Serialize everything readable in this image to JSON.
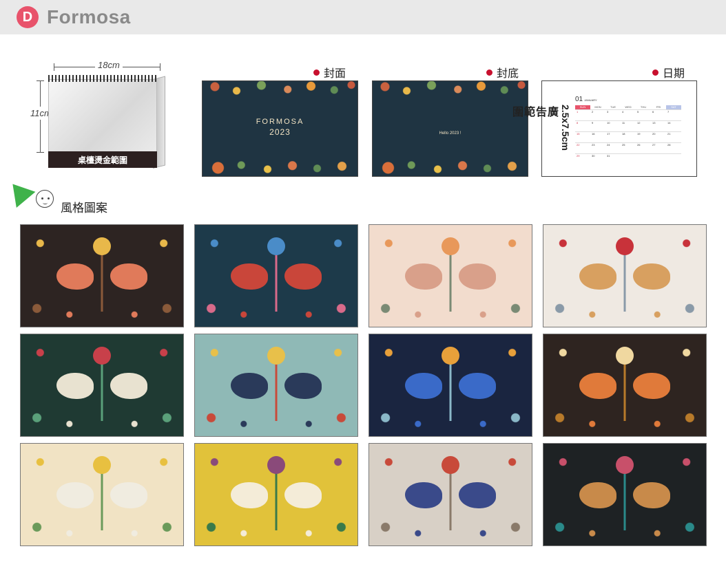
{
  "header": {
    "badge": "D",
    "brand": "Formosa"
  },
  "product": {
    "width_label": "18cm",
    "height_label": "11cm",
    "strip_label": "桌檯燙金範圍"
  },
  "previews": {
    "front": {
      "label": "封面",
      "title": "FORMOSA",
      "year": "2023"
    },
    "back": {
      "label": "封底",
      "text": "Hello 2023 !"
    },
    "date": {
      "label": "日期",
      "ad_text": "廣告範圍",
      "ad_size": "2.5x7.5cm",
      "month_number": "01",
      "month_name": "JANUARY",
      "weekdays": [
        "SUN",
        "MON",
        "TUE",
        "WED",
        "THU",
        "FRI",
        "SAT"
      ],
      "weeks": [
        [
          "1",
          "2",
          "3",
          "4",
          "5",
          "6",
          "7"
        ],
        [
          "8",
          "9",
          "10",
          "11",
          "12",
          "13",
          "14"
        ],
        [
          "15",
          "16",
          "17",
          "18",
          "19",
          "20",
          "21"
        ],
        [
          "22",
          "23",
          "24",
          "25",
          "26",
          "27",
          "28"
        ],
        [
          "29",
          "30",
          "31",
          "",
          "",
          "",
          ""
        ]
      ]
    }
  },
  "styles": {
    "title": "風格圖案",
    "thumbnails": [
      {
        "bg": "#2d2422",
        "axis": "#8a5a3a",
        "motif": "#e07a5a",
        "flower": "#e8b84a"
      },
      {
        "bg": "#1d3a4a",
        "axis": "#d96a8a",
        "motif": "#c9463a",
        "flower": "#4a8cc8"
      },
      {
        "bg": "#f2dccd",
        "axis": "#7a8a74",
        "motif": "#d9a08a",
        "flower": "#e8985a"
      },
      {
        "bg": "#efe9e2",
        "axis": "#8a9aa8",
        "motif": "#d8a060",
        "flower": "#c8323a"
      },
      {
        "bg": "#1f3a33",
        "axis": "#5aa07a",
        "motif": "#e8e2d0",
        "flower": "#c8404a"
      },
      {
        "bg": "#8fb9b6",
        "axis": "#c84a3a",
        "motif": "#2a3a5a",
        "flower": "#e8c04a"
      },
      {
        "bg": "#1a2540",
        "axis": "#8ab8c8",
        "motif": "#3a6ac8",
        "flower": "#e8a03a"
      },
      {
        "bg": "#2e2420",
        "axis": "#b87a2a",
        "motif": "#e07a3a",
        "flower": "#f0d8a0"
      },
      {
        "bg": "#f1e3c4",
        "axis": "#6a9a5a",
        "motif": "#f0ece0",
        "flower": "#e8c040"
      },
      {
        "bg": "#e1c23a",
        "axis": "#3a7a4a",
        "motif": "#f4ecd8",
        "flower": "#8a4a7a"
      },
      {
        "bg": "#d8d0c6",
        "axis": "#8a7a6a",
        "motif": "#3a4a8a",
        "flower": "#c84a3a"
      },
      {
        "bg": "#1e2224",
        "axis": "#2a8a8a",
        "motif": "#c88a4a",
        "flower": "#c8506a"
      }
    ]
  }
}
